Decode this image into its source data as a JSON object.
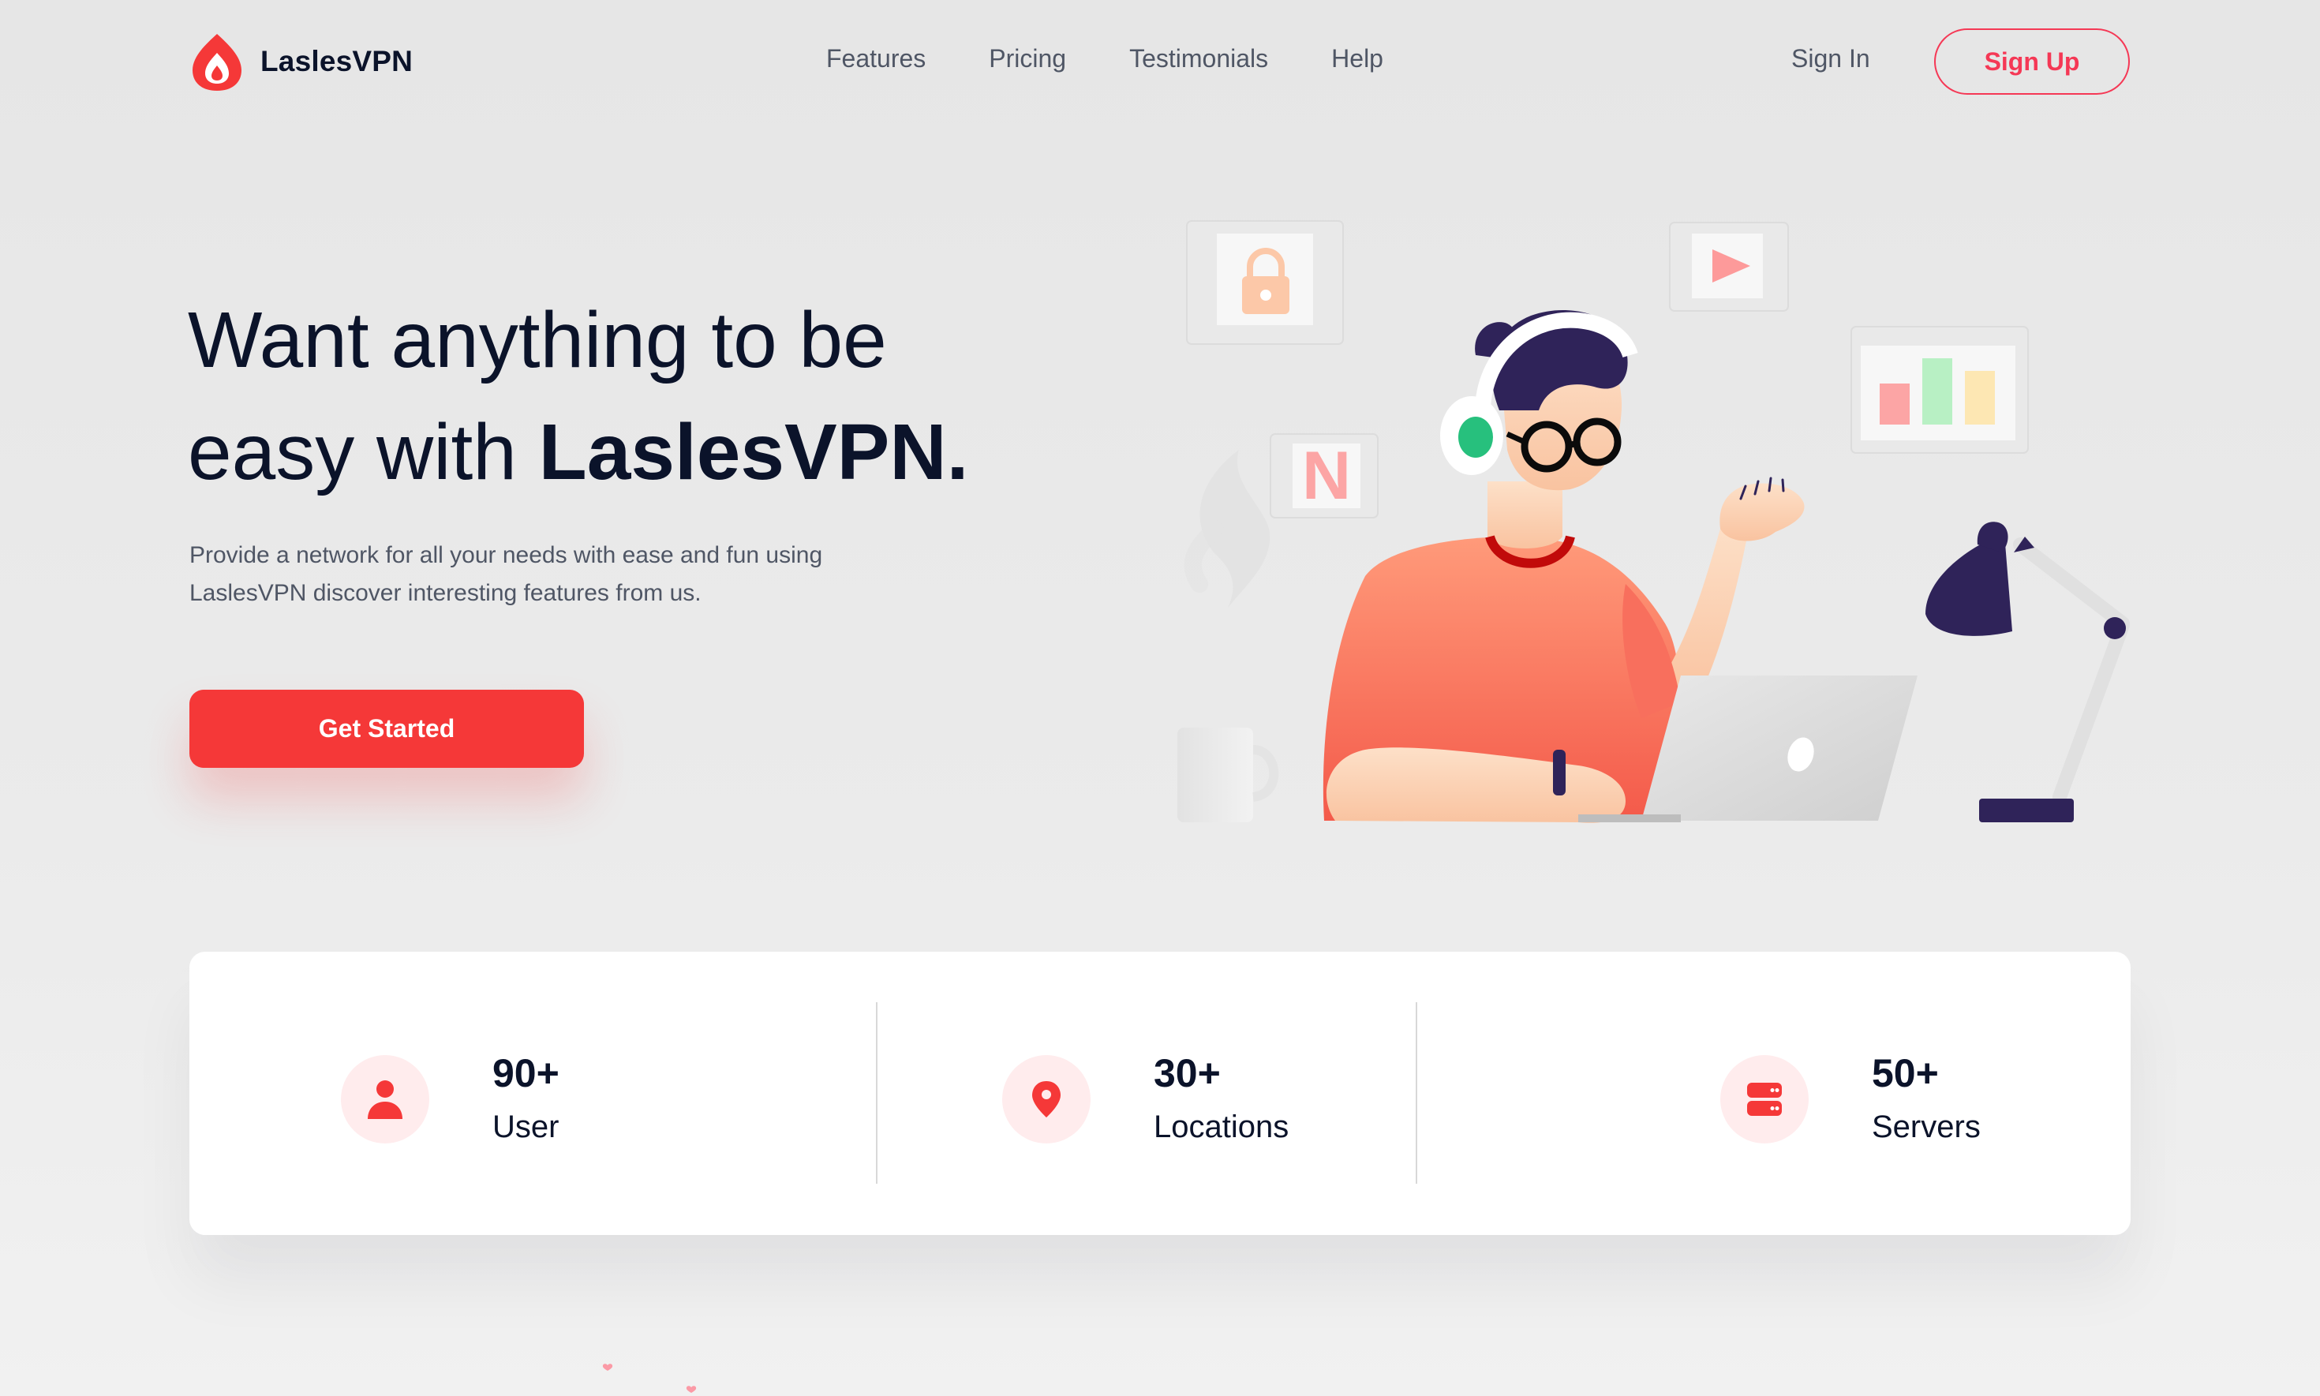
{
  "brand": {
    "name": "LaslesVPN",
    "accent_color": "#f53838",
    "logo_icon": "flame-drop-logo-icon"
  },
  "nav": {
    "links": [
      {
        "label": "Features"
      },
      {
        "label": "Pricing"
      },
      {
        "label": "Testimonials"
      },
      {
        "label": "Help"
      }
    ],
    "sign_in": "Sign In",
    "sign_up": "Sign Up"
  },
  "hero": {
    "title_line1": "Want anything to be",
    "title_line2_prefix": "easy with ",
    "title_brand": "LaslesVPN.",
    "description_line1": "Provide a network for all your needs with ease and fun using",
    "description_line2": "LaslesVPN discover interesting features from us.",
    "cta": "Get Started"
  },
  "illustration": {
    "subject": "person with headphones and glasses working on laptop",
    "floating_icons": [
      "lock-icon",
      "play-icon",
      "netflix-n-icon",
      "bar-chart-icon"
    ],
    "netflix_letter": "N"
  },
  "stats": [
    {
      "value": "90+",
      "label": "User",
      "icon": "user-icon"
    },
    {
      "value": "30+",
      "label": "Locations",
      "icon": "location-pin-icon"
    },
    {
      "value": "50+",
      "label": "Servers",
      "icon": "server-icon"
    }
  ]
}
